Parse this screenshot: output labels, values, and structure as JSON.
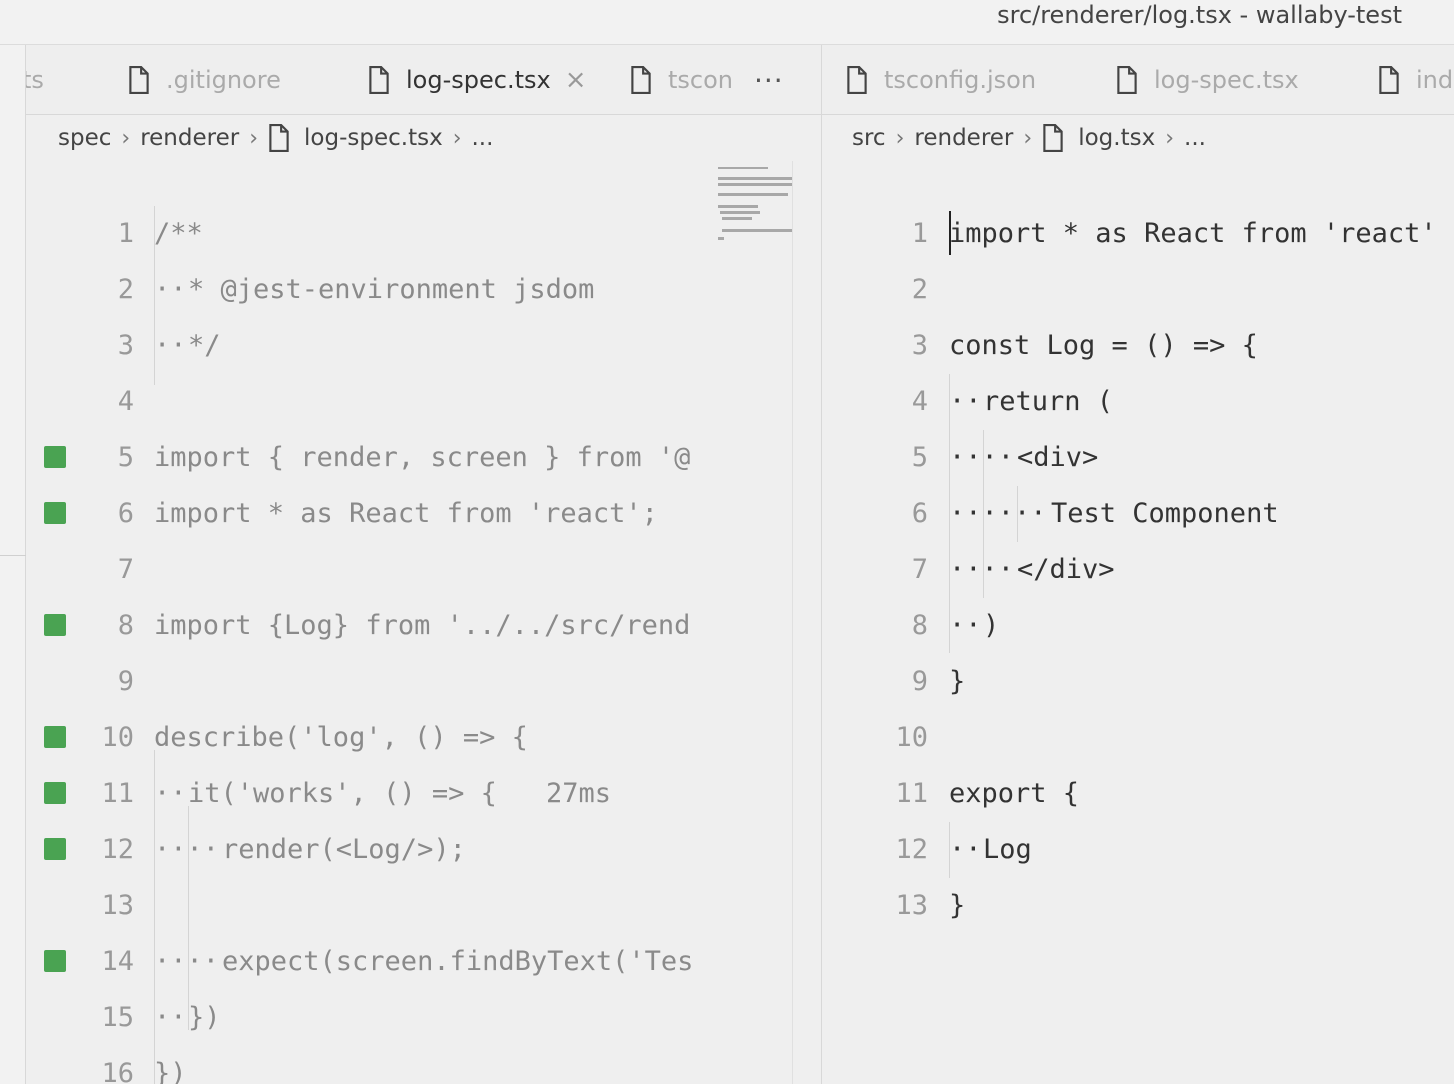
{
  "window": {
    "title": "src/renderer/log.tsx - wallaby-test"
  },
  "left": {
    "tabs": [
      {
        "label": "ts",
        "active": false
      },
      {
        "label": ".gitignore",
        "active": false
      },
      {
        "label": "log-spec.tsx",
        "active": true,
        "close": "×"
      },
      {
        "label": "tscon",
        "active": false
      }
    ],
    "more": "···",
    "breadcrumb": [
      "spec",
      "renderer",
      "log-spec.tsx",
      "..."
    ],
    "lines": [
      {
        "n": "1",
        "text": "/**"
      },
      {
        "n": "2",
        "text": "* @jest-environment jsdom"
      },
      {
        "n": "3",
        "text": "*/"
      },
      {
        "n": "4",
        "text": ""
      },
      {
        "n": "5",
        "text": "import { render, screen } from '@"
      },
      {
        "n": "6",
        "text": "import * as React from 'react';"
      },
      {
        "n": "7",
        "text": ""
      },
      {
        "n": "8",
        "text": "import {Log} from '../../src/rend"
      },
      {
        "n": "9",
        "text": ""
      },
      {
        "n": "10",
        "text": "describe('log', () => {"
      },
      {
        "n": "11",
        "text": "it('works', () => {"
      },
      {
        "n": "12",
        "text": "render(<Log/>);"
      },
      {
        "n": "13",
        "text": ""
      },
      {
        "n": "14",
        "text": "expect(screen.findByText('Tes"
      },
      {
        "n": "15",
        "text": "})"
      },
      {
        "n": "16",
        "text": "})"
      }
    ],
    "timing": "27ms"
  },
  "right": {
    "tabs": [
      {
        "label": "tsconfig.json",
        "active": false
      },
      {
        "label": "log-spec.tsx",
        "active": false
      },
      {
        "label": "ind",
        "active": false
      }
    ],
    "breadcrumb": [
      "src",
      "renderer",
      "log.tsx",
      "..."
    ],
    "lines": [
      {
        "n": "1",
        "text": "import * as React from 'react'"
      },
      {
        "n": "2",
        "text": ""
      },
      {
        "n": "3",
        "text": "const Log = () => {"
      },
      {
        "n": "4",
        "text": "return ("
      },
      {
        "n": "5",
        "text": "<div>"
      },
      {
        "n": "6",
        "text": "Test Component"
      },
      {
        "n": "7",
        "text": "</div>"
      },
      {
        "n": "8",
        "text": ")"
      },
      {
        "n": "9",
        "text": "}"
      },
      {
        "n": "10",
        "text": ""
      },
      {
        "n": "11",
        "text": "export {"
      },
      {
        "n": "12",
        "text": "Log"
      },
      {
        "n": "13",
        "text": "}"
      }
    ]
  },
  "colors": {
    "coverage": "#4aa352",
    "timing": "#1a1aff",
    "background": "#efefef"
  },
  "icons": {
    "file": "file-icon",
    "chevron": "chevron-right-icon",
    "close": "close-icon",
    "more": "more-icon"
  }
}
